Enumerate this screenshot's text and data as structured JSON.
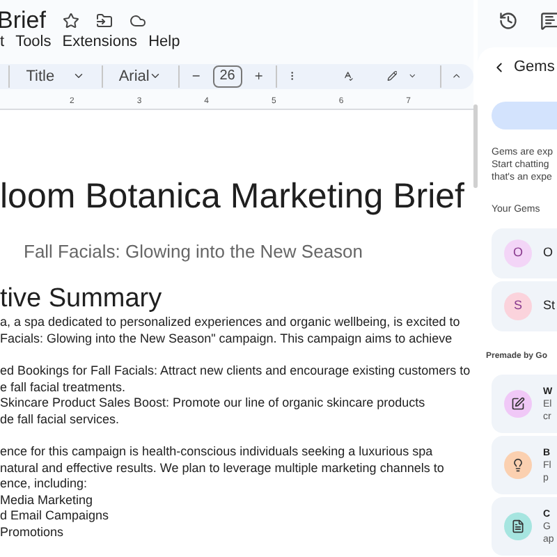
{
  "doc_title": "Brief",
  "menu": [
    "t",
    "Tools",
    "Extensions",
    "Help"
  ],
  "toolbar": {
    "style": "Title",
    "font": "Arial",
    "font_size": "26"
  },
  "ruler": [
    "2",
    "3",
    "4",
    "5",
    "6",
    "7"
  ],
  "document": {
    "title": "loom Botanica Marketing Brief",
    "subtitle": "Fall Facials: Glowing into the New Season",
    "heading": "tive Summary",
    "paragraphs": [
      [
        "a, a spa dedicated to personalized experiences and organic wellbeing, is excited to",
        " Facials: Glowing into the New Season\" campaign. This campaign aims to achieve"
      ],
      [
        "ed Bookings for Fall Facials: Attract new clients and encourage existing customers to",
        "e fall facial treatments.",
        " Skincare Product Sales Boost:  Promote our line of organic skincare products",
        "de fall facial services."
      ],
      [
        "ence for this campaign is health-conscious individuals seeking a luxurious spa",
        " natural and effective results. We plan to leverage multiple marketing channels to",
        "ence, including:",
        "Media Marketing",
        "d Email Campaigns",
        "Promotions"
      ]
    ]
  },
  "gems_panel": {
    "title": "Gems",
    "intro": [
      "Gems are exp",
      "Start chatting",
      "that's an expe"
    ],
    "your_gems_label": "Your Gems",
    "your_gems": [
      {
        "initial": "O",
        "name": "O",
        "color": "#f3d5f7"
      },
      {
        "initial": "S",
        "name": "St",
        "color": "#fbd3dc"
      }
    ],
    "premade_label": "Premade by Go",
    "premade": [
      {
        "kind": "edit",
        "name": "W",
        "lines": [
          "El",
          "cr"
        ],
        "color": "#f0c8f7"
      },
      {
        "kind": "bulb",
        "name": "B",
        "lines": [
          "Fl",
          "p"
        ],
        "color": "#fbd0b0"
      },
      {
        "kind": "doc",
        "name": "C",
        "lines": [
          "G",
          "ap"
        ],
        "color": "#a6e5e0"
      }
    ]
  }
}
